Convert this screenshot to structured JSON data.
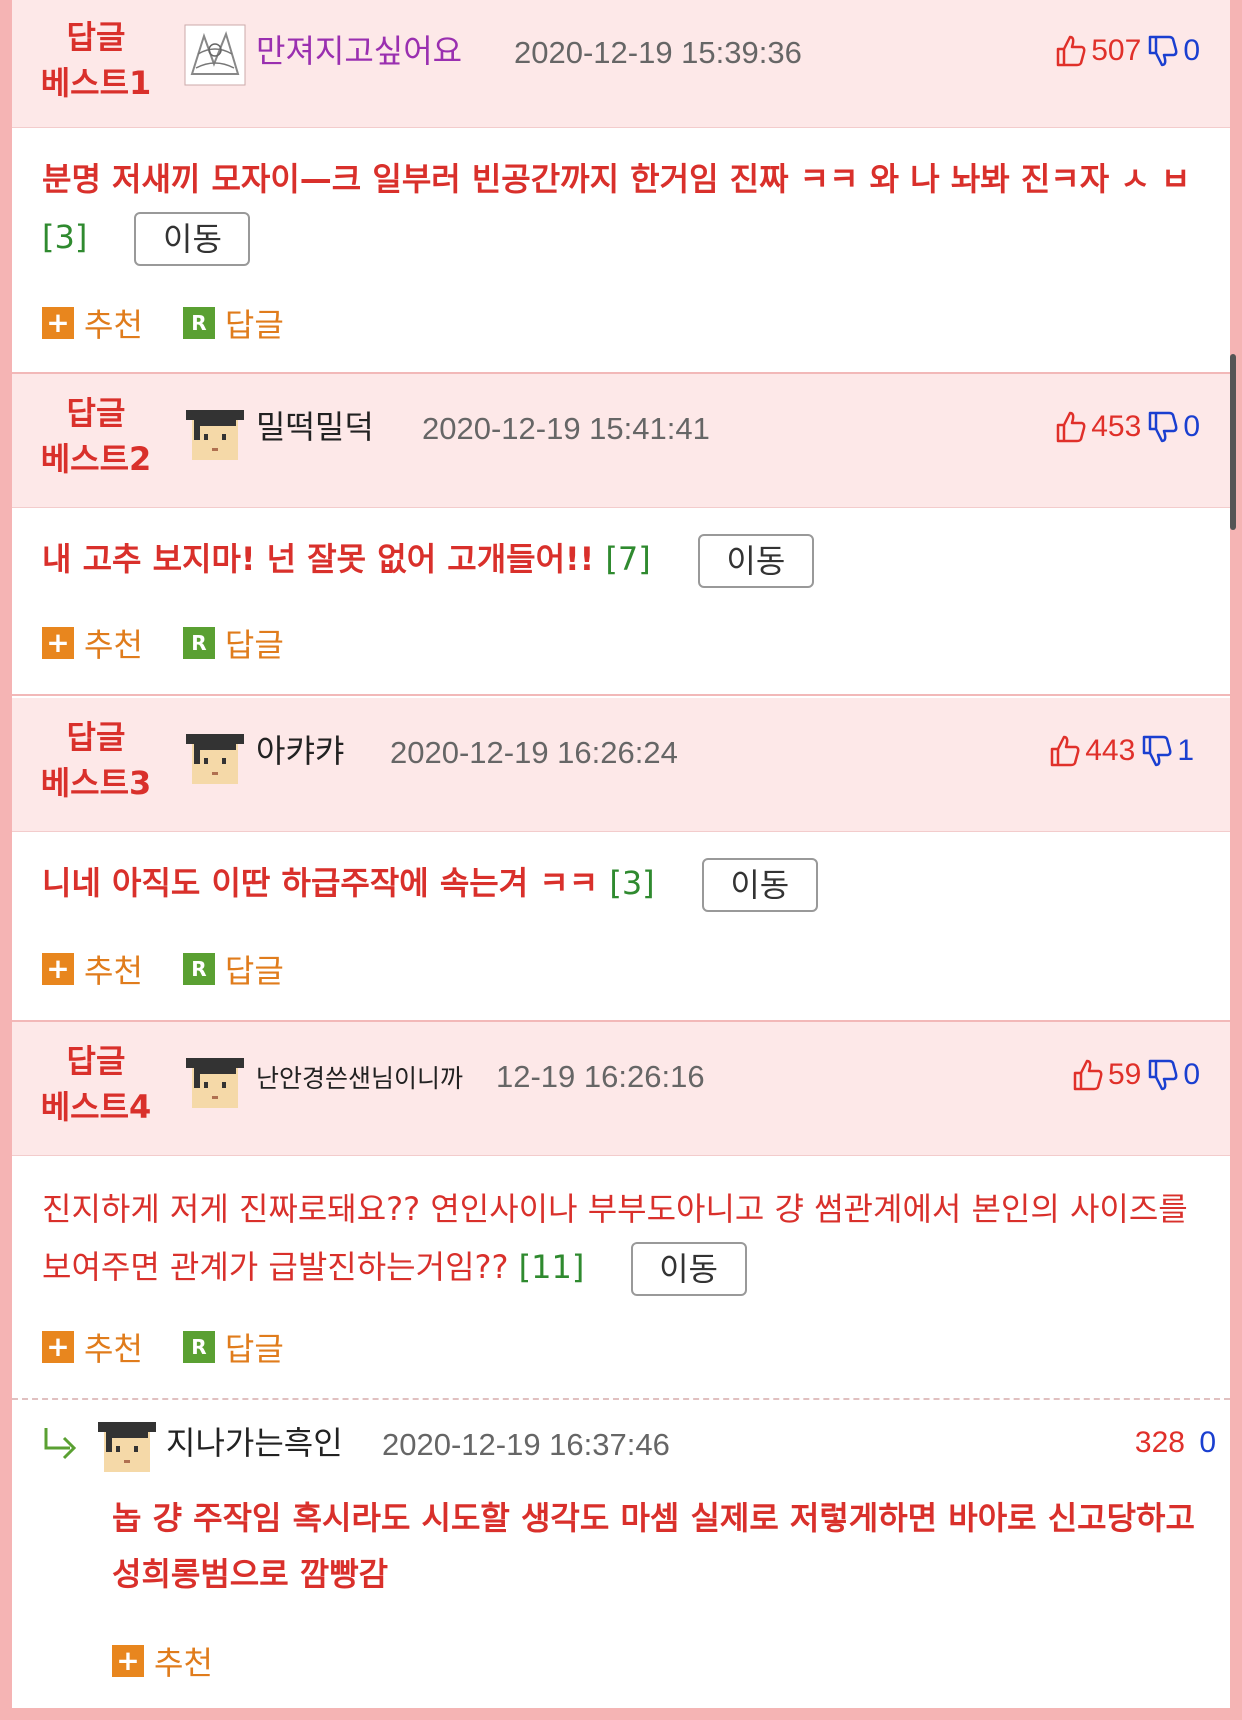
{
  "best_label_line1": "답글",
  "action_recommend": "추천",
  "action_reply": "답글",
  "move_label": "이동",
  "comments": [
    {
      "best_label_line2": "베스트1",
      "nickname": "만져지고싶어요",
      "date": "2020-12-19 15:39:36",
      "up": "507",
      "down": "0",
      "text": "분명 저새끼 모자이—크 일부러 빈공간까지 한거임 진짜 ㅋㅋ 와 나 놔봐 진ㅋ자 ㅅ ㅂ",
      "count": "[3]"
    },
    {
      "best_label_line2": "베스트2",
      "nickname": "밀떡밀덕",
      "date": "2020-12-19 15:41:41",
      "up": "453",
      "down": "0",
      "text": "내 고추 보지마! 넌 잘못 없어 고개들어!!",
      "count": "[7]"
    },
    {
      "best_label_line2": "베스트3",
      "nickname": "아캬캬",
      "date": "2020-12-19 16:26:24",
      "up": "443",
      "down": "1",
      "text": "니네 아직도 이딴 하급주작에 속는겨 ㅋㅋ",
      "count": "[3]"
    },
    {
      "best_label_line2": "베스트4",
      "nickname": "난안경쓴샌님이니까",
      "date": "12-19 16:26:16",
      "up": "59",
      "down": "0",
      "text": "진지하게 저게 진짜로돼요?? 연인사이나 부부도아니고 걍 썸관계에서 본인의 사이즈를 보여주면 관계가 급발진하는거임??",
      "count": "[11]"
    }
  ],
  "reply": {
    "nickname": "지나가는흑인",
    "date": "2020-12-19 16:37:46",
    "up": "328",
    "down": "0",
    "text": "놉 걍 주작임 혹시라도 시도할 생각도 마셈 실제로 저렇게하면 바아로 신고당하고 성희롱범으로 깜빵감"
  },
  "colors": {
    "best_header_bg": "#fde8e8",
    "accent_red": "#d9302b",
    "down_blue": "#1a3fd0",
    "count_green": "#2f8a2f",
    "recommend_orange": "#e8861e",
    "reply_green": "#5aa032",
    "page_border": "#f5b4b4"
  },
  "icons": [
    "thumbs-up-icon",
    "thumbs-down-icon",
    "plus-icon",
    "r-reply-icon",
    "reply-arrow-icon",
    "avatar-icon"
  ]
}
